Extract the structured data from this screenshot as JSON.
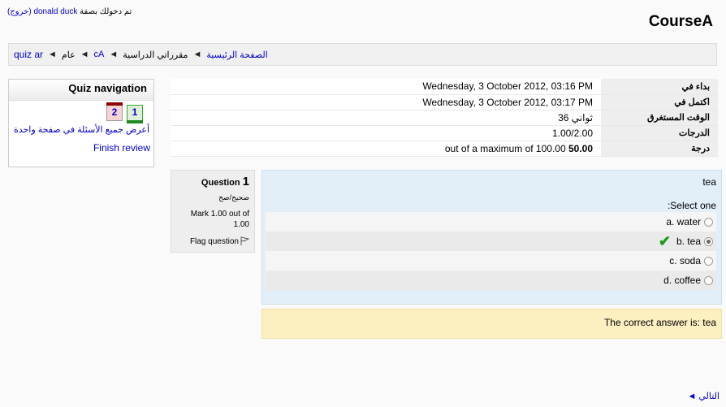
{
  "header": {
    "login_prefix": "تم دخولك بصفة",
    "user_name": "donald duck",
    "logout": "(خروج)",
    "course_title": "CourseA"
  },
  "breadcrumb": {
    "home": "الصفحة الرئيسية",
    "my_courses": "مقرراتي الدراسية",
    "course": "cA",
    "section": "عام",
    "quiz": "quiz ar",
    "separator": "◄"
  },
  "quiz_nav": {
    "title": "Quiz navigation",
    "questions": [
      "1",
      "2"
    ],
    "show_all": "أعرض جميع الأسئلة في صفحة واحدة",
    "finish": "Finish review"
  },
  "summary": {
    "rows": [
      {
        "label": "بداء في",
        "value": "Wednesday, 3 October 2012, 03:16 PM"
      },
      {
        "label": "اكتمل في",
        "value": "Wednesday, 3 October 2012, 03:17 PM"
      },
      {
        "label": "الوقت المستغرق",
        "value": "36 ثواني"
      },
      {
        "label": "الدرجات",
        "value": "1.00/2.00"
      },
      {
        "label": "درجة",
        "value_bold": "50.00",
        "value_rest": "out of a maximum of 100.00"
      }
    ]
  },
  "question": {
    "label": "Question",
    "number": "1",
    "state": "صحيح/صح",
    "mark": "Mark 1.00 out of 1.00",
    "flag": "Flag question",
    "text": "tea",
    "prompt": "Select one:",
    "answers": [
      {
        "label": "a. water"
      },
      {
        "label": "b. tea"
      },
      {
        "label": "c. soda"
      },
      {
        "label": "d. coffee"
      }
    ],
    "selected_index": 1,
    "feedback": "The correct answer is: tea"
  },
  "footer": {
    "next": "التالي",
    "next_arrow": "◄"
  },
  "colors": {
    "link": "#0000cc",
    "content_bg": "#e2eef8",
    "feedback_bg": "#fcefc0",
    "correct_tick": "#1d9a1d"
  }
}
